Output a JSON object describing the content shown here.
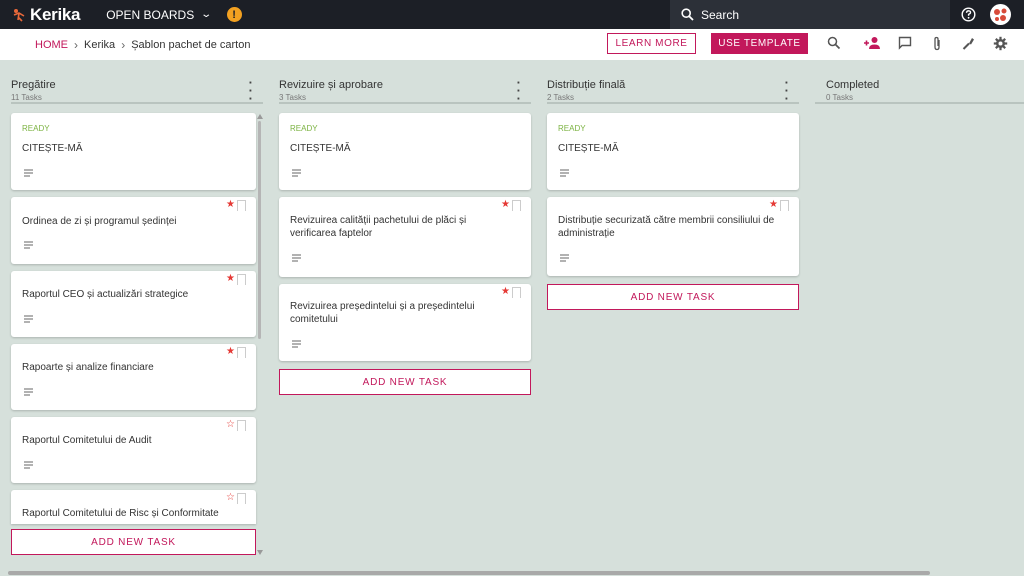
{
  "topbar": {
    "brand": "Kerika",
    "boards_label": "OPEN BOARDS",
    "alert_glyph": "!",
    "search_label": "Search"
  },
  "subbar": {
    "breadcrumb": {
      "home": "HOME",
      "workspace": "Kerika",
      "board": "Șablon pachet de carton"
    },
    "learn_more": "LEARN MORE",
    "use_template": "USE TEMPLATE",
    "tools": [
      "search-icon",
      "add-person-icon",
      "chat-icon",
      "attachment-icon",
      "wrench-icon",
      "gear-icon"
    ]
  },
  "columns": [
    {
      "title": "Pregătire",
      "count": "11 Tasks",
      "add_label": "ADD NEW TASK",
      "cards": [
        {
          "status": "READY",
          "title": "CITEȘTE-MĂ",
          "star": "none"
        },
        {
          "status": "",
          "title": "Ordinea de zi și programul ședinței",
          "star": "filled"
        },
        {
          "status": "",
          "title": "Raportul CEO și actualizări strategice",
          "star": "filled"
        },
        {
          "status": "",
          "title": "Rapoarte și analize financiare",
          "star": "filled"
        },
        {
          "status": "",
          "title": "Raportul Comitetului de Audit",
          "star": "outline"
        },
        {
          "status": "",
          "title": "Raportul Comitetului de Risc și Conformitate",
          "star": "outline"
        }
      ]
    },
    {
      "title": "Revizuire și aprobare",
      "count": "3 Tasks",
      "add_label": "ADD NEW TASK",
      "cards": [
        {
          "status": "READY",
          "title": "CITEȘTE-MĂ",
          "star": "none"
        },
        {
          "status": "",
          "title": "Revizuirea calității pachetului de plăci și verificarea faptelor",
          "star": "filled"
        },
        {
          "status": "",
          "title": "Revizuirea președintelui și a președintelui comitetului",
          "star": "filled"
        }
      ]
    },
    {
      "title": "Distribuție finală",
      "count": "2 Tasks",
      "add_label": "ADD NEW TASK",
      "cards": [
        {
          "status": "READY",
          "title": "CITEȘTE-MĂ",
          "star": "none"
        },
        {
          "status": "",
          "title": "Distribuție securizată către membrii consiliului de administrație",
          "star": "filled"
        }
      ]
    },
    {
      "title": "Completed",
      "count": "0 Tasks",
      "cards": []
    }
  ],
  "colors": {
    "accent": "#c2185b",
    "ready": "#7cb342",
    "topbar": "#1c1f26",
    "board_bg": "#d6e0db",
    "star": "#e53935"
  }
}
